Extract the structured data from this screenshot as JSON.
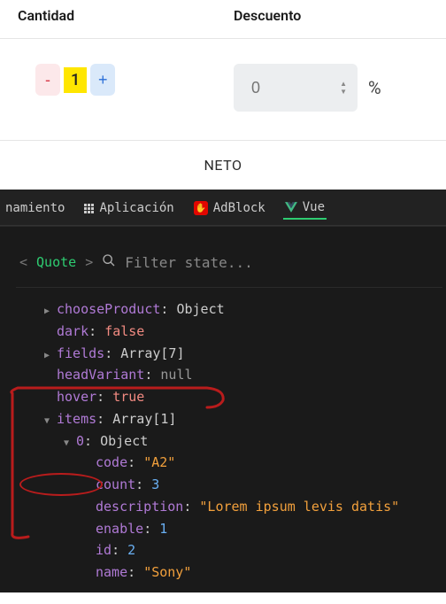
{
  "app": {
    "headers": {
      "qty": "Cantidad",
      "discount": "Descuento"
    },
    "qty": {
      "value": "1",
      "minus": "-",
      "plus": "+"
    },
    "discount": {
      "placeholder": "0",
      "pct": "%"
    },
    "neto": "NETO"
  },
  "devtools": {
    "tabs": [
      {
        "label": "namiento"
      },
      {
        "label": "Aplicación"
      },
      {
        "label": "AdBlock"
      },
      {
        "label": "Vue"
      }
    ],
    "component": "Quote",
    "filter_placeholder": "Filter state...",
    "state": {
      "chooseProduct": "Object",
      "dark": "false",
      "fields": "Array[7]",
      "headVariant": "null",
      "hover": "true",
      "items": {
        "label": "Array[1]",
        "0": {
          "label": "Object",
          "code": "\"A2\"",
          "count": "3",
          "description": "\"Lorem ipsum levis datis\"",
          "enable": "1",
          "id": "2",
          "name": "\"Sony\""
        }
      }
    }
  }
}
